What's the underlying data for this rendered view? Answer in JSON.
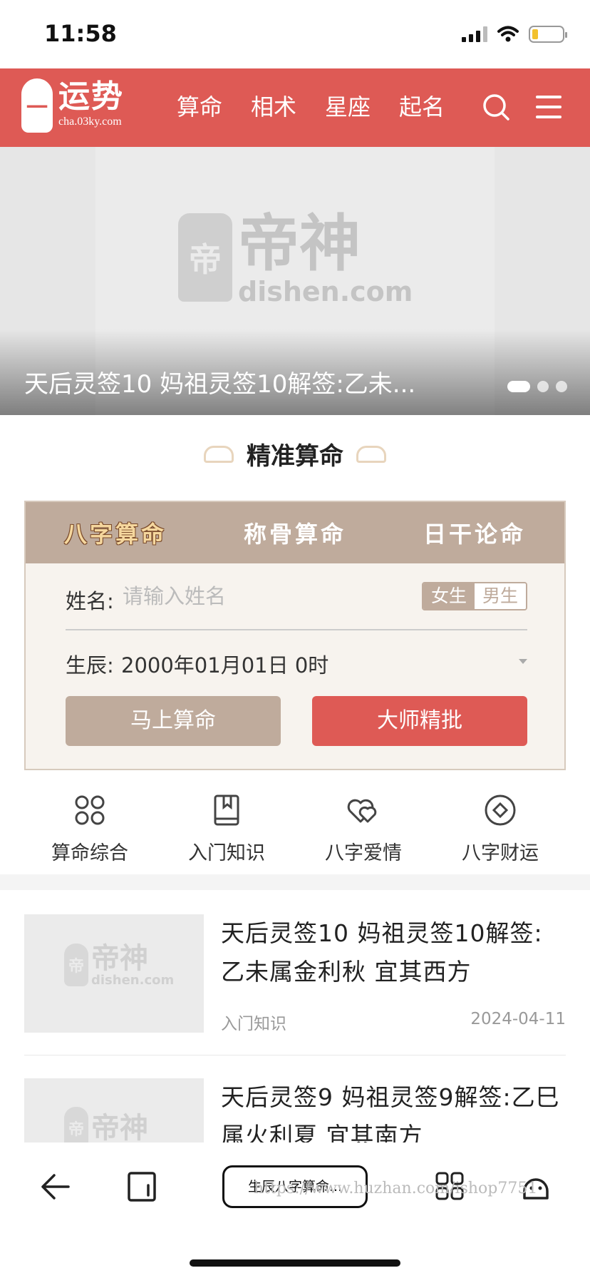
{
  "status_bar": {
    "time": "11:58"
  },
  "header": {
    "logo_seal": "一",
    "logo_name": "运势",
    "logo_url": "cha.03ky.com",
    "nav": [
      "算命",
      "相术",
      "星座",
      "起名"
    ]
  },
  "banner": {
    "caption": "天后灵签10 妈祖灵签10解签:乙未...",
    "watermark_name": "帝神",
    "watermark_url": "dishen.com",
    "watermark_seal": "帝",
    "active_dot": 0
  },
  "section": {
    "title": "精准算命"
  },
  "form": {
    "tabs": [
      "八字算命",
      "称骨算命",
      "日干论命"
    ],
    "active_tab": 0,
    "name_label": "姓名:",
    "name_placeholder": "请输入姓名",
    "name_value": "",
    "gender_female": "女生",
    "gender_male": "男生",
    "selected_gender": "女生",
    "birth_label": "生辰:",
    "birth_value": "2000年01月01日 0时",
    "btn_quick": "马上算命",
    "btn_master": "大师精批"
  },
  "quick_links": [
    {
      "label": "算命综合",
      "icon": "grid-icon"
    },
    {
      "label": "入门知识",
      "icon": "book-icon"
    },
    {
      "label": "八字爱情",
      "icon": "hearts-icon"
    },
    {
      "label": "八字财运",
      "icon": "coin-icon"
    }
  ],
  "articles": [
    {
      "title": "天后灵签10 妈祖灵签10解签:乙未属金利秋 宜其西方",
      "category": "入门知识",
      "date": "2024-04-11"
    },
    {
      "title": "天后灵签9 妈祖灵签9解签:乙巳属火利夏 宜其南方",
      "category": "",
      "date": ""
    }
  ],
  "toolbar": {
    "pill_label": "生辰八字算命...",
    "url_watermark": "https://www.huzhan.com/ishop7751"
  },
  "colors": {
    "brand": "#de5a55",
    "tan": "#bfab9c",
    "card_bg": "#f7f3ee"
  }
}
